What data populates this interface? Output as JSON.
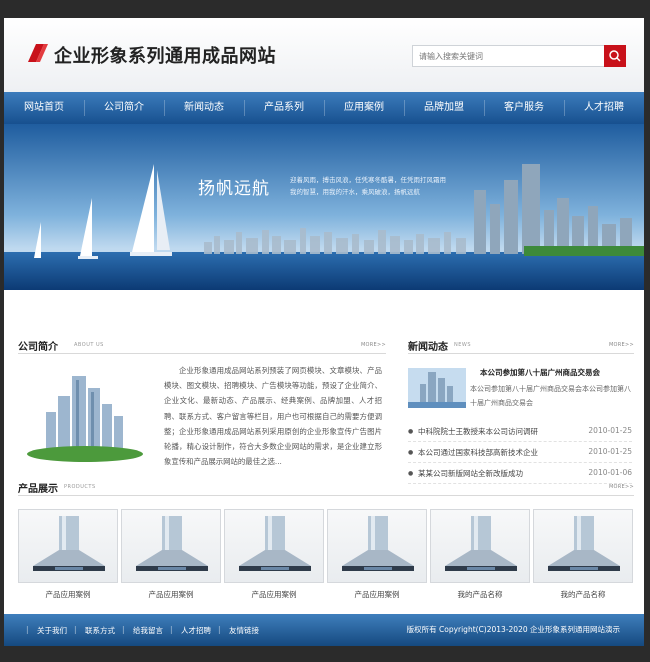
{
  "header": {
    "title": "企业形象系列通用成品网站",
    "search_placeholder": "请输入搜索关键词"
  },
  "nav": [
    "网站首页",
    "公司简介",
    "新闻动态",
    "产品系列",
    "应用案例",
    "品牌加盟",
    "客户服务",
    "人才招聘"
  ],
  "banner": {
    "title": "扬帆远航",
    "text": "迎着风雨，搏击风浪，任凭寒冬酷暑，任凭雨打风霜用我的智慧，用我的汗水，乘风破浪，扬帆远航"
  },
  "about": {
    "title": "公司简介",
    "subtitle": "ABOUT US",
    "more": "MORE>>",
    "text": "企业形象通用成品网站系列预装了网页模块、文章模块、产品模块、图文模块、招聘模块、广告模块等功能，预设了企业简介、企业文化、最新动态、产品展示、经典案例、品牌加盟、人才招聘、联系方式、客户留言等栏目，用户也可根据自己的需要方便调整；企业形象通用成品网站系列采用原创的企业形象宣传广告图片轮播，精心设计制作，符合大多数企业网站的需求，是企业建立形象宣传和产品展示网站的最佳之选..."
  },
  "news": {
    "title": "新闻动态",
    "subtitle": "NEWS",
    "more": "MORE>>",
    "feature_title": "本公司参加第八十届广州商品交易会",
    "feature_summary": "本公司参加第八十届广州商品交易会本公司参加第八十届广州商品交易会",
    "items": [
      {
        "title": "中科院院士王教授来本公司访问调研",
        "date": "2010-01-25"
      },
      {
        "title": "本公司通过国家科技部高新技术企业",
        "date": "2010-01-25"
      },
      {
        "title": "某某公司新版网站全新改版成功",
        "date": "2010-01-06"
      }
    ]
  },
  "products": {
    "title": "产品展示",
    "subtitle": "PRODUCTS",
    "more": "MORE>>",
    "items": [
      "产品应用案例",
      "产品应用案例",
      "产品应用案例",
      "产品应用案例",
      "我的产品名称",
      "我的产品名称"
    ]
  },
  "footer": {
    "links": [
      "关于我们",
      "联系方式",
      "给我留言",
      "人才招聘",
      "友情链接"
    ],
    "copyright": "版权所有 Copyright(C)2013-2020 企业形象系列通用网站演示"
  },
  "colors": {
    "accent": "#c8111a",
    "nav": "#1f5c9c"
  }
}
